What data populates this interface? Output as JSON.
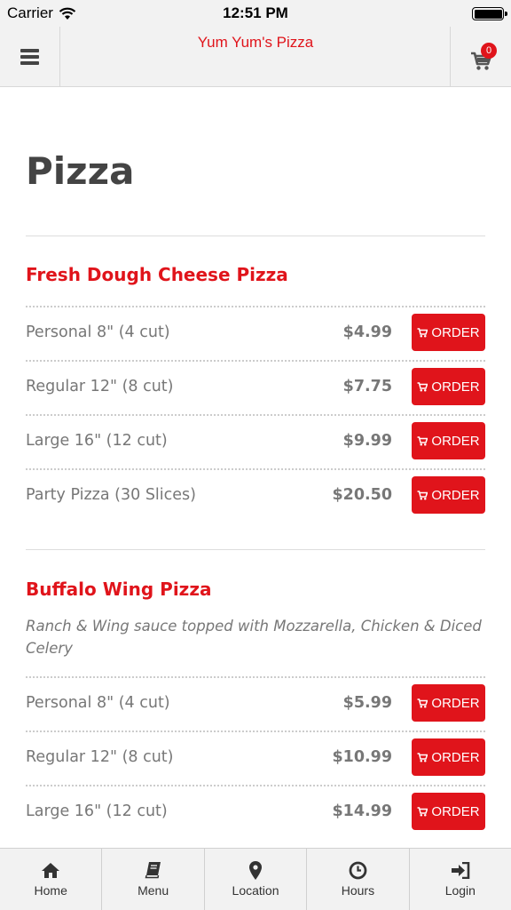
{
  "status_bar": {
    "carrier": "Carrier",
    "time": "12:51 PM"
  },
  "header": {
    "title": "Yum Yum's Pizza",
    "cart_count": "0",
    "menu_icon": "hamburger-icon",
    "cart_icon": "cart-icon"
  },
  "page": {
    "title": "Pizza"
  },
  "sections": [
    {
      "title": "Fresh Dough Cheese Pizza",
      "description": "",
      "items": [
        {
          "size": "Personal 8\" (4 cut)",
          "price": "$4.99",
          "button": "ORDER"
        },
        {
          "size": "Regular 12\" (8 cut)",
          "price": "$7.75",
          "button": "ORDER"
        },
        {
          "size": "Large 16\" (12 cut)",
          "price": "$9.99",
          "button": "ORDER"
        },
        {
          "size": "Party Pizza (30 Slices)",
          "price": "$20.50",
          "button": "ORDER"
        }
      ]
    },
    {
      "title": "Buffalo Wing Pizza",
      "description": "Ranch & Wing sauce topped with Mozzarella, Chicken & Diced Celery",
      "items": [
        {
          "size": "Personal 8\" (4 cut)",
          "price": "$5.99",
          "button": "ORDER"
        },
        {
          "size": "Regular 12\" (8 cut)",
          "price": "$10.99",
          "button": "ORDER"
        },
        {
          "size": "Large 16\" (12 cut)",
          "price": "$14.99",
          "button": "ORDER"
        }
      ]
    }
  ],
  "tabbar": [
    {
      "label": "Home",
      "icon": "home-icon"
    },
    {
      "label": "Menu",
      "icon": "book-icon"
    },
    {
      "label": "Location",
      "icon": "map-pin-icon"
    },
    {
      "label": "Hours",
      "icon": "clock-icon"
    },
    {
      "label": "Login",
      "icon": "login-icon"
    }
  ],
  "colors": {
    "accent": "#e0141b",
    "bar_bg": "#f2f2f2",
    "text_muted": "#777777"
  }
}
